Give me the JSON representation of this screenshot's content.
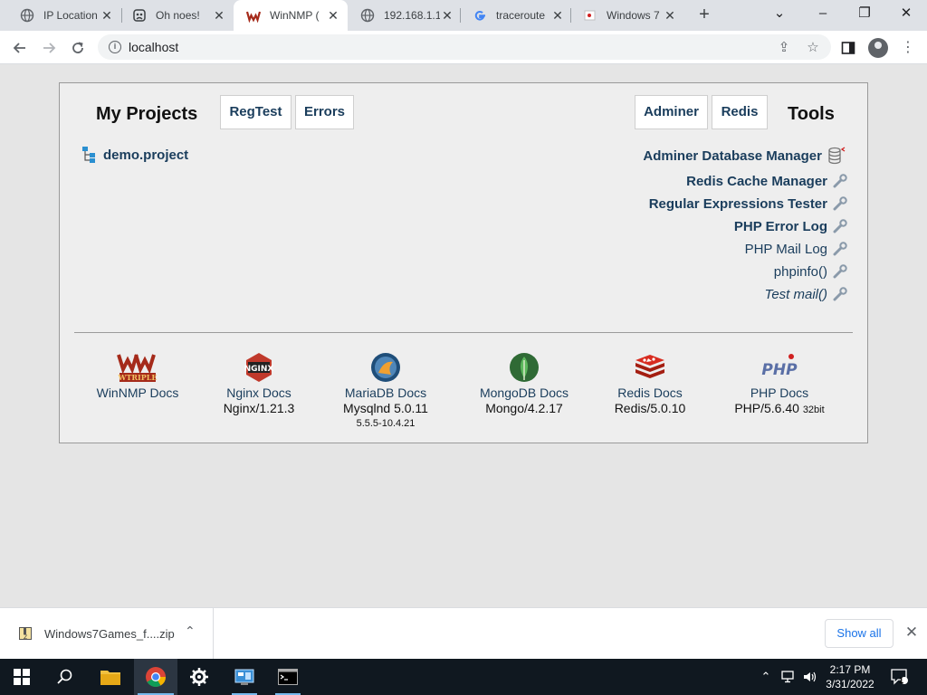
{
  "browser": {
    "tabs": [
      {
        "title": "IP Location",
        "icon": "globe-icon",
        "active": false
      },
      {
        "title": "Oh noes!",
        "icon": "oh-noes-icon",
        "active": false
      },
      {
        "title": "WinNMP (",
        "icon": "winnmp-icon",
        "active": true
      },
      {
        "title": "192.168.1.1",
        "icon": "globe-icon",
        "active": false
      },
      {
        "title": "traceroute",
        "icon": "google-icon",
        "active": false
      },
      {
        "title": "Windows 7",
        "icon": "windows-game-icon",
        "active": false
      }
    ],
    "new_tab": "+",
    "window_controls": {
      "minimize": "–",
      "restore": "❐",
      "close": "✕",
      "tab_search": "⌄"
    },
    "address": "localhost"
  },
  "page": {
    "my_projects_title": "My Projects",
    "tools_title": "Tools",
    "header_buttons_left": [
      "RegTest",
      "Errors"
    ],
    "header_buttons_right": [
      "Adminer",
      "Redis"
    ],
    "projects": [
      {
        "name": "demo.project"
      }
    ],
    "tools": [
      {
        "label": "Adminer Database Manager",
        "icon": "database-icon",
        "style": "bold"
      },
      {
        "label": "Redis Cache Manager",
        "icon": "wrench-icon",
        "style": "bold"
      },
      {
        "label": "Regular Expressions Tester",
        "icon": "wrench-icon",
        "style": "bold"
      },
      {
        "label": "PHP Error Log",
        "icon": "wrench-icon",
        "style": "bold"
      },
      {
        "label": "PHP Mail Log",
        "icon": "wrench-icon",
        "style": "normal"
      },
      {
        "label": "phpinfo()",
        "icon": "wrench-icon",
        "style": "normal"
      },
      {
        "label": "Test mail()",
        "icon": "wrench-icon",
        "style": "italic"
      }
    ],
    "docs": [
      {
        "link": "WinNMP Docs",
        "version": "",
        "sub": "",
        "icon": "wtriple-logo"
      },
      {
        "link": "Nginx Docs",
        "version": "Nginx/1.21.3",
        "sub": "",
        "icon": "nginx-logo"
      },
      {
        "link": "MariaDB Docs",
        "version": "Mysqlnd 5.0.11",
        "sub": "5.5.5-10.4.21",
        "icon": "mariadb-logo"
      },
      {
        "link": "MongoDB Docs",
        "version": "Mongo/4.2.17",
        "sub": "",
        "icon": "mongodb-logo"
      },
      {
        "link": "Redis Docs",
        "version": "Redis/5.0.10",
        "sub": "",
        "icon": "redis-logo"
      },
      {
        "link": "PHP Docs",
        "version": "PHP/5.6.40",
        "version_suffix": "32bit",
        "sub": "",
        "icon": "php-logo"
      }
    ]
  },
  "downloads": {
    "file": "Windows7Games_f....zip",
    "show_all": "Show all"
  },
  "taskbar": {
    "time": "2:17 PM",
    "date": "3/31/2022",
    "notification_count": "1"
  }
}
